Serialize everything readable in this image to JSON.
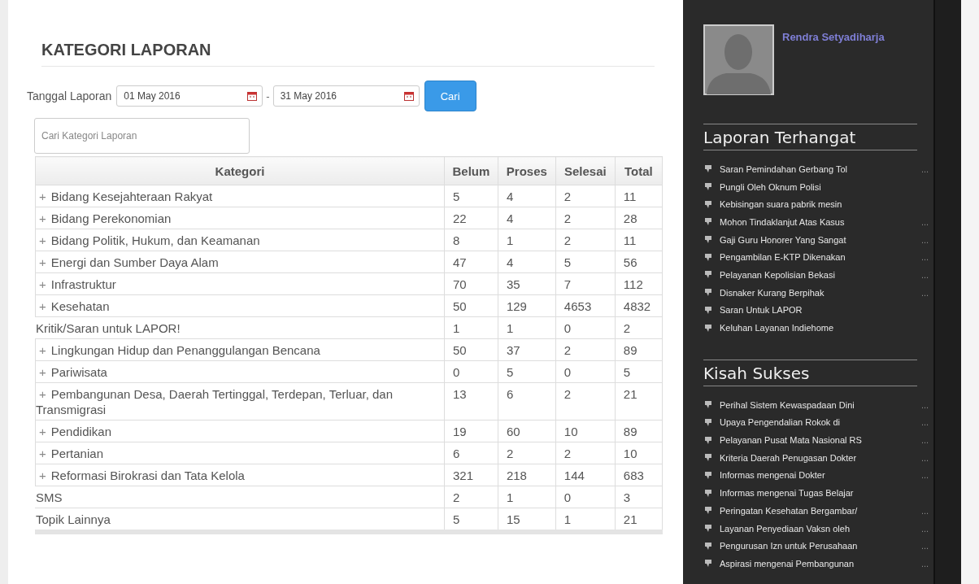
{
  "page": {
    "title": "KATEGORI LAPORAN"
  },
  "filter": {
    "label": "Tanggal Laporan",
    "date_from": "01 May 2016",
    "separator": "-",
    "date_to": "31 May 2016",
    "button": "Cari"
  },
  "search": {
    "placeholder": "Cari Kategori Laporan"
  },
  "table": {
    "columns": [
      "Kategori",
      "Belum",
      "Proses",
      "Selesai",
      "Total"
    ],
    "rows": [
      {
        "toggle": "+",
        "cells": [
          "Bidang Kesejahteraan Rakyat",
          "5",
          "4",
          "2",
          "11"
        ]
      },
      {
        "toggle": "+",
        "cells": [
          "Bidang Perekonomian",
          "22",
          "4",
          "2",
          "28"
        ]
      },
      {
        "toggle": "+",
        "cells": [
          "Bidang Politik, Hukum, dan Keamanan",
          "8",
          "1",
          "2",
          "11"
        ]
      },
      {
        "toggle": "+",
        "cells": [
          "Energi dan Sumber Daya Alam",
          "47",
          "4",
          "5",
          "56"
        ]
      },
      {
        "toggle": "+",
        "cells": [
          "Infrastruktur",
          "70",
          "35",
          "7",
          "112"
        ]
      },
      {
        "toggle": "+",
        "cells": [
          "Kesehatan",
          "50",
          "129",
          "4653",
          "4832"
        ]
      },
      {
        "cells": [
          "Kritik/Saran untuk LAPOR!",
          "1",
          "1",
          "0",
          "2"
        ]
      },
      {
        "toggle": "+",
        "cells": [
          "Lingkungan Hidup dan Penanggulangan Bencana",
          "50",
          "37",
          "2",
          "89"
        ]
      },
      {
        "toggle": "+",
        "cells": [
          "Pariwisata",
          "0",
          "5",
          "0",
          "5"
        ]
      },
      {
        "toggle": "+",
        "cells": [
          "Pembangunan Desa, Daerah Tertinggal, Terdepan, Terluar, dan Transmigrasi",
          "13",
          "6",
          "2",
          "21"
        ]
      },
      {
        "toggle": "+",
        "cells": [
          "Pendidikan",
          "19",
          "60",
          "10",
          "89"
        ]
      },
      {
        "toggle": "+",
        "cells": [
          "Pertanian",
          "6",
          "2",
          "2",
          "10"
        ]
      },
      {
        "toggle": "+",
        "cells": [
          "Reformasi Birokrasi dan Tata Kelola",
          "321",
          "218",
          "144",
          "683"
        ]
      },
      {
        "cells": [
          "SMS",
          "2",
          "1",
          "0",
          "3"
        ]
      },
      {
        "cells": [
          "Topik Lainnya",
          "5",
          "15",
          "1",
          "21"
        ]
      }
    ]
  },
  "sidebar": {
    "user": {
      "name": "Rendra Setyadiharja"
    },
    "sections": [
      {
        "title": "Laporan Terhangat",
        "items": [
          {
            "text": "Saran Pemindahan Gerbang Tol",
            "more": "..."
          },
          {
            "text": "Pungli Oleh Oknum Polisi"
          },
          {
            "text": "Kebisingan suara pabrik mesin"
          },
          {
            "text": "Mohon Tindaklanjut Atas Kasus",
            "more": "..."
          },
          {
            "text": "Gaji Guru Honorer Yang Sangat",
            "more": "..."
          },
          {
            "text": "Pengambilan E-KTP Dikenakan",
            "more": "..."
          },
          {
            "text": "Pelayanan Kepolisian Bekasi",
            "more": "..."
          },
          {
            "text": "Disnaker Kurang Berpihak",
            "more": "..."
          },
          {
            "text": "Saran Untuk LAPOR"
          },
          {
            "text": "Keluhan Layanan Indiehome"
          }
        ]
      },
      {
        "title": "Kisah Sukses",
        "items": [
          {
            "text": "Perihal Sistem Kewaspadaan Dini",
            "more": "..."
          },
          {
            "text": "Upaya Pengendalian Rokok di",
            "more": "..."
          },
          {
            "text": "Pelayanan Pusat Mata Nasional RS",
            "more": "..."
          },
          {
            "text": "Kriteria Daerah Penugasan Dokter",
            "more": "..."
          },
          {
            "text": "Informas mengenai Dokter",
            "more": "..."
          },
          {
            "text": "Informas mengenai Tugas Belajar"
          },
          {
            "text": "Peringatan Kesehatan Bergambar/",
            "more": "..."
          },
          {
            "text": "Layanan Penyediaan Vaksn oleh",
            "more": "..."
          },
          {
            "text": "Pengurusan Izn untuk Perusahaan",
            "more": "..."
          },
          {
            "text": "Aspirasi mengenai Pembangunan",
            "more": "..."
          }
        ]
      }
    ]
  }
}
